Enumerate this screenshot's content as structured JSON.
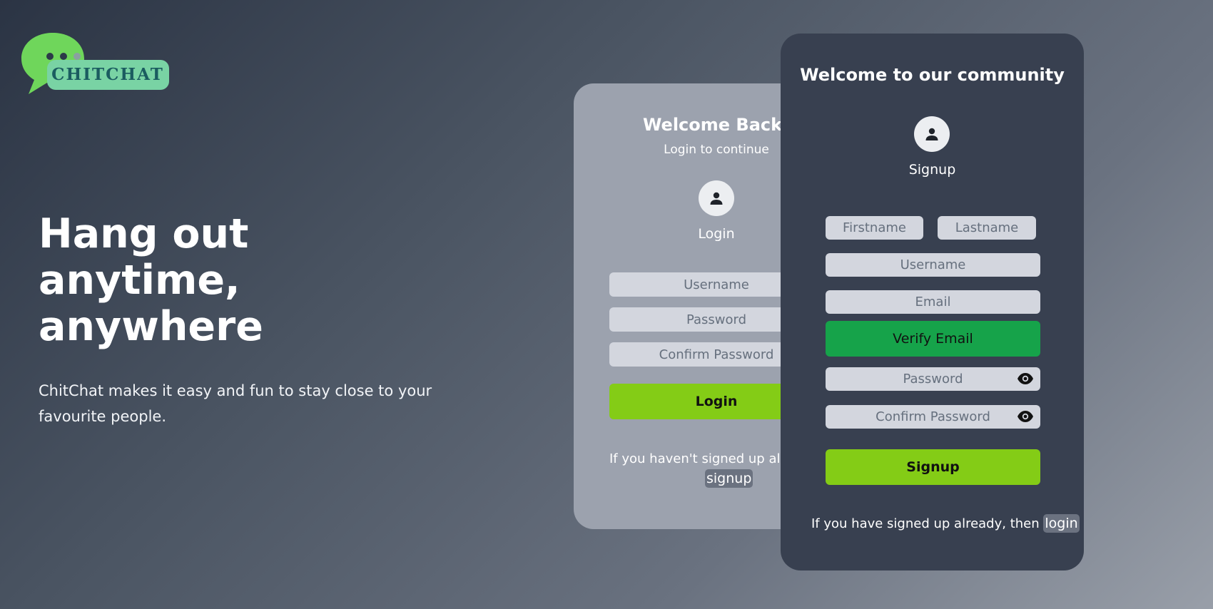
{
  "brand": {
    "name": "CHITCHAT",
    "colors": {
      "bubble": "#6fd65b",
      "tag": "#79d3a4",
      "text": "#1b5c60"
    }
  },
  "hero": {
    "title": "Hang out anytime, anywhere",
    "subtitle": "ChitChat makes it easy and fun to stay close to your favourite people."
  },
  "login": {
    "title": "Welcome Back!",
    "subtitle": "Login to continue",
    "avatar_icon": "user-icon",
    "avatar_label": "Login",
    "username_placeholder": "Username",
    "password_placeholder": "Password",
    "confirm_placeholder": "Confirm Password",
    "button_label": "Login",
    "switch_text": "If you haven't signed up already, then ",
    "switch_link": "signup"
  },
  "signup": {
    "title": "Welcome to our community",
    "avatar_icon": "user-icon",
    "avatar_label": "Signup",
    "firstname_placeholder": "Firstname",
    "lastname_placeholder": "Lastname",
    "username_placeholder": "Username",
    "email_placeholder": "Email",
    "verify_label": "Verify Email",
    "password_placeholder": "Password",
    "confirm_placeholder": "Confirm Password",
    "eye_icon": "eye-icon",
    "button_label": "Signup",
    "switch_text": "If you have signed up already, then ",
    "switch_link": "login"
  },
  "colors": {
    "lime": "#84cc16",
    "green": "#16a34a",
    "signup_card": "#384050",
    "login_card": "#9ca2ae",
    "field": "#d3d6de"
  }
}
